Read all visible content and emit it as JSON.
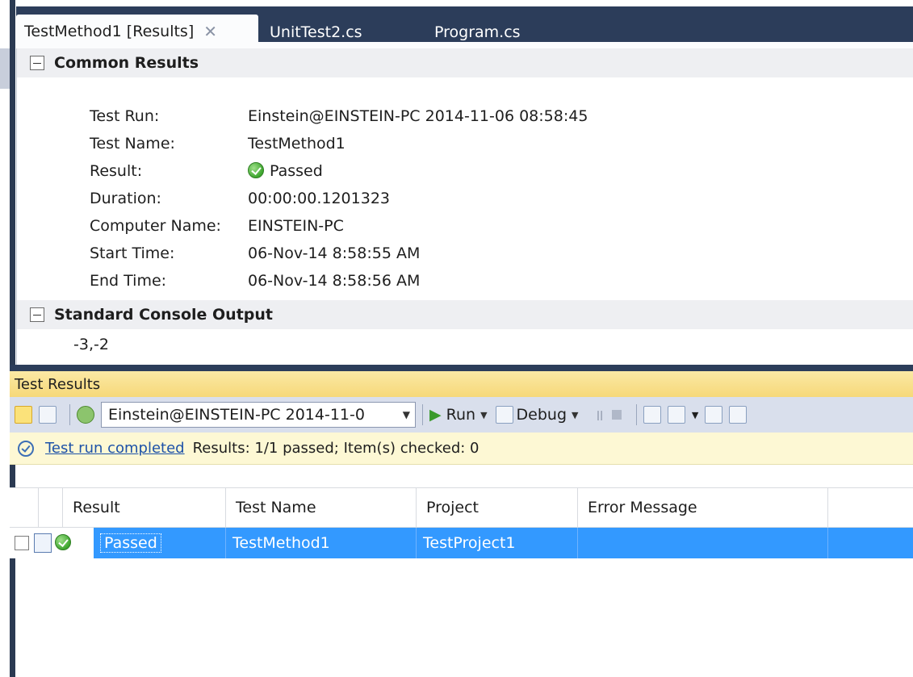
{
  "tabs": [
    {
      "label": "TestMethod1 [Results]",
      "active": true
    },
    {
      "label": "UnitTest2.cs",
      "active": false
    },
    {
      "label": "Program.cs",
      "active": false
    }
  ],
  "common_results": {
    "header": "Common Results",
    "fields": [
      {
        "key": "Test Run:",
        "value": "Einstein@EINSTEIN-PC 2014-11-06 08:58:45"
      },
      {
        "key": "Test Name:",
        "value": "TestMethod1"
      },
      {
        "key": "Result:",
        "value": "Passed"
      },
      {
        "key": "Duration:",
        "value": "00:00:00.1201323"
      },
      {
        "key": "Computer Name:",
        "value": "EINSTEIN-PC"
      },
      {
        "key": "Start Time:",
        "value": "06-Nov-14 8:58:55 AM"
      },
      {
        "key": "End Time:",
        "value": "06-Nov-14 8:58:56 AM"
      }
    ]
  },
  "console_output": {
    "header": "Standard Console Output",
    "text": "-3,-2"
  },
  "test_results_window": {
    "title": "Test Results",
    "toolbar": {
      "run_selector": "Einstein@EINSTEIN-PC 2014-11-0",
      "run_label": "Run",
      "debug_label": "Debug"
    },
    "status": {
      "link": "Test run completed",
      "summary": "Results: 1/1 passed;  Item(s) checked: 0"
    },
    "columns": [
      "Result",
      "Test Name",
      "Project",
      "Error Message"
    ],
    "rows": [
      {
        "result": "Passed",
        "test_name": "TestMethod1",
        "project": "TestProject1",
        "error_message": ""
      }
    ]
  },
  "colors": {
    "tab_strip": "#2c3d5a",
    "toolwindow_title": "#f6d879",
    "selection": "#3399ff",
    "link": "#1d52a8"
  }
}
